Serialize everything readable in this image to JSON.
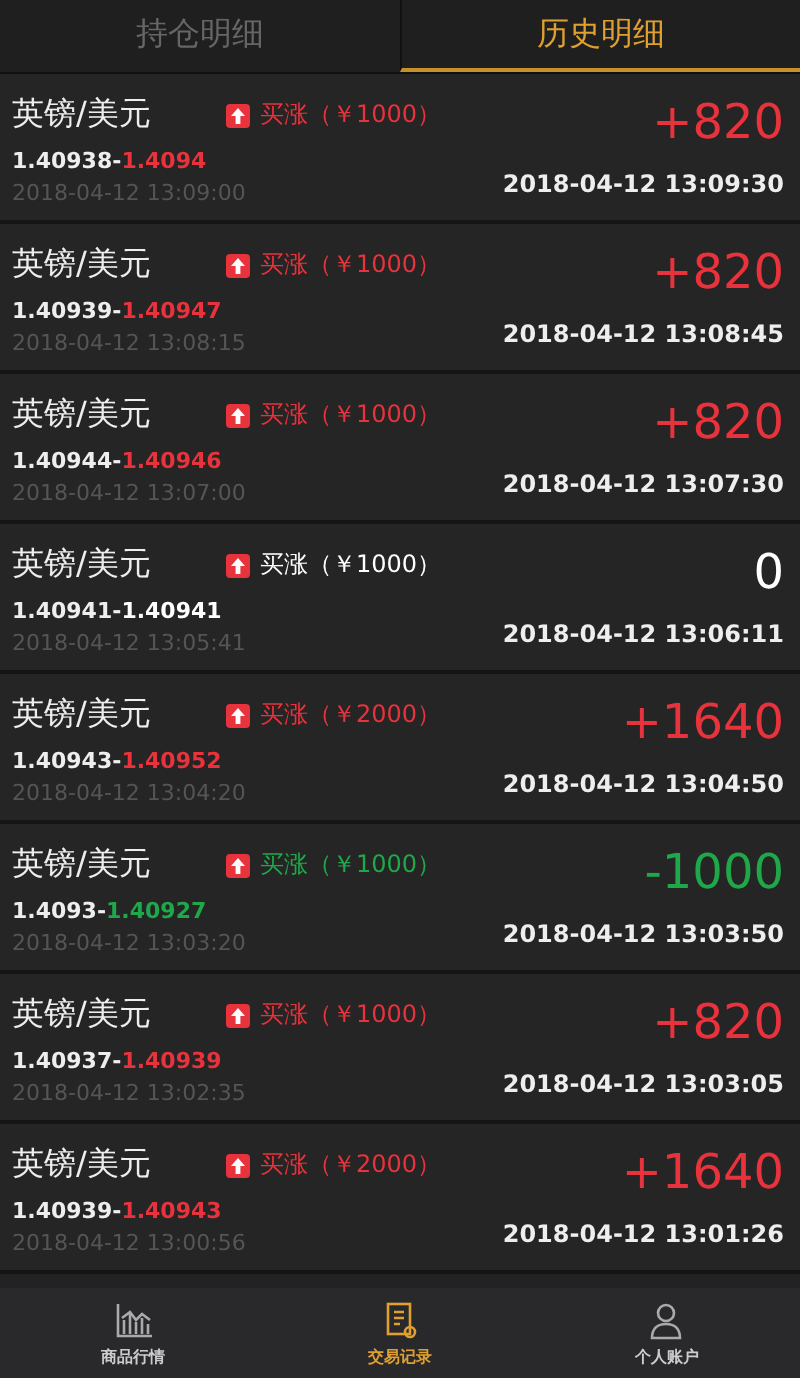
{
  "tabs": [
    {
      "label": "持仓明细",
      "selected": false
    },
    {
      "label": "历史明细",
      "selected": true
    }
  ],
  "orders": [
    {
      "pair": "英镑/美元",
      "kind": "gain",
      "direction": "买涨（￥1000）",
      "open_price": "1.40938",
      "separator": "-",
      "close_price": "1.4094",
      "open_time": "2018-04-12 13:09:00",
      "profit": "+820",
      "close_time": "2018-04-12 13:09:30"
    },
    {
      "pair": "英镑/美元",
      "kind": "gain",
      "direction": "买涨（￥1000）",
      "open_price": "1.40939",
      "separator": "-",
      "close_price": "1.40947",
      "open_time": "2018-04-12 13:08:15",
      "profit": "+820",
      "close_time": "2018-04-12 13:08:45"
    },
    {
      "pair": "英镑/美元",
      "kind": "gain",
      "direction": "买涨（￥1000）",
      "open_price": "1.40944",
      "separator": "-",
      "close_price": "1.40946",
      "open_time": "2018-04-12 13:07:00",
      "profit": "+820",
      "close_time": "2018-04-12 13:07:30"
    },
    {
      "pair": "英镑/美元",
      "kind": "even",
      "direction": "买涨（￥1000）",
      "open_price": "1.40941",
      "separator": "-",
      "close_price": "1.40941",
      "open_time": "2018-04-12 13:05:41",
      "profit": "0",
      "close_time": "2018-04-12 13:06:11"
    },
    {
      "pair": "英镑/美元",
      "kind": "gain",
      "direction": "买涨（￥2000）",
      "open_price": "1.40943",
      "separator": "-",
      "close_price": "1.40952",
      "open_time": "2018-04-12 13:04:20",
      "profit": "+1640",
      "close_time": "2018-04-12 13:04:50"
    },
    {
      "pair": "英镑/美元",
      "kind": "loss",
      "direction": "买涨（￥1000）",
      "open_price": "1.4093",
      "separator": "-",
      "close_price": "1.40927",
      "open_time": "2018-04-12 13:03:20",
      "profit": "-1000",
      "close_time": "2018-04-12 13:03:50"
    },
    {
      "pair": "英镑/美元",
      "kind": "gain",
      "direction": "买涨（￥1000）",
      "open_price": "1.40937",
      "separator": "-",
      "close_price": "1.40939",
      "open_time": "2018-04-12 13:02:35",
      "profit": "+820",
      "close_time": "2018-04-12 13:03:05"
    },
    {
      "pair": "英镑/美元",
      "kind": "gain",
      "direction": "买涨（￥2000）",
      "open_price": "1.40939",
      "separator": "-",
      "close_price": "1.40943",
      "open_time": "2018-04-12 13:00:56",
      "profit": "+1640",
      "close_time": "2018-04-12 13:01:26"
    }
  ],
  "bottom_nav": [
    {
      "label": "商品行情",
      "selected": false
    },
    {
      "label": "交易记录",
      "selected": true
    },
    {
      "label": "个人账户",
      "selected": false
    }
  ]
}
